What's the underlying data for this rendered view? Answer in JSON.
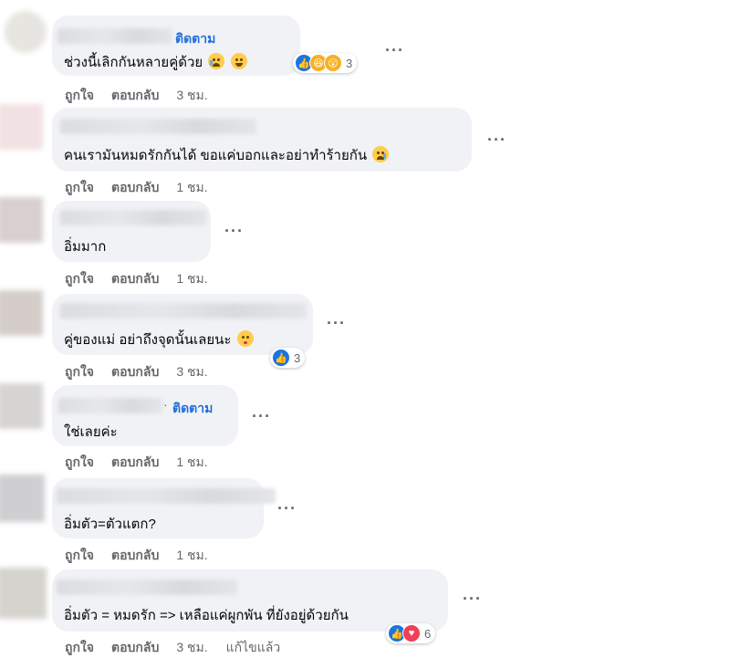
{
  "actions": {
    "like": "ถูกใจ",
    "reply": "ตอบกลับ",
    "edited": "แก้ไขแล้ว"
  },
  "colors": {
    "bubble": "#f0f2f5",
    "link_blue": "#216fdb",
    "meta_gray": "#65676b",
    "like_blue": "#1b74e4",
    "love_red": "#f33e58"
  },
  "more_icon": "···",
  "comments": [
    {
      "follow": "ติดตาม",
      "text": "ช่วงนี้เลิกกันหลายคู่ด้วย",
      "text_emojis": [
        "crying-face",
        "grinning-face"
      ],
      "reactions": [
        "like",
        "haha",
        "wow"
      ],
      "reaction_count": "3",
      "time": "3 ชม."
    },
    {
      "text": "คนเรามันหมดรักกันได้ ขอแค่บอกและอย่าทำร้ายกัน",
      "text_emojis": [
        "sad-relieved-face"
      ],
      "time": "1 ชม."
    },
    {
      "text": "อิ่มมาก",
      "time": "1 ชม."
    },
    {
      "text": "คู่ของแม่ อย่าถึงจุดนั้นเลยนะ",
      "text_emojis": [
        "kissing-face"
      ],
      "reactions": [
        "like"
      ],
      "reaction_count": "3",
      "time": "3 ชม."
    },
    {
      "follow_dot": "·",
      "follow": "ติดตาม",
      "text": "ใช่เลยค่ะ",
      "time": "1 ชม."
    },
    {
      "text": "อิ่มตัว=ตัวแตก?",
      "time": "1 ชม."
    },
    {
      "text": "อิ่มตัว = หมดรัก => เหลือแค่ผูกพัน ที่ยังอยู่ด้วยกัน",
      "reactions": [
        "like",
        "love"
      ],
      "reaction_count": "6",
      "time": "3 ชม.",
      "edited": true
    }
  ]
}
